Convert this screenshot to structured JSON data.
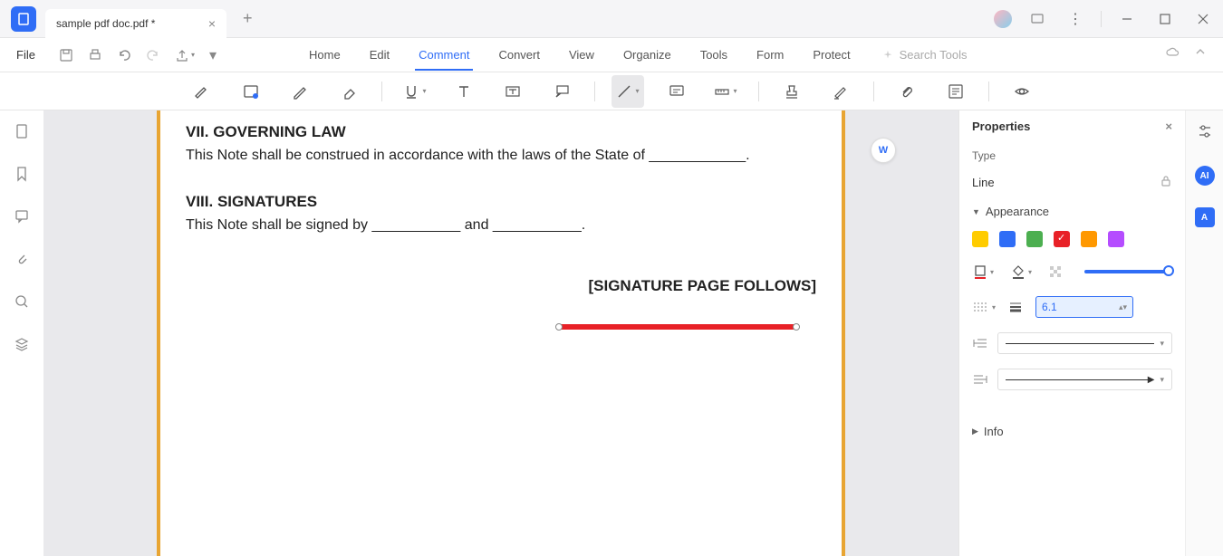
{
  "titlebar": {
    "tab_title": "sample pdf doc.pdf *"
  },
  "menubar": {
    "file": "File",
    "tabs": [
      "Home",
      "Edit",
      "Comment",
      "Convert",
      "View",
      "Organize",
      "Tools",
      "Form",
      "Protect"
    ],
    "active_index": 2,
    "search_placeholder": "Search Tools"
  },
  "document": {
    "heading1": "VII. GOVERNING LAW",
    "para1": "This Note shall be construed in accordance with the laws of the State of ____________.",
    "heading2": "VIII. SIGNATURES",
    "para2": "This Note shall be signed by ___________ and ___________.",
    "sig_follows": "[SIGNATURE PAGE FOLLOWS]"
  },
  "properties": {
    "title": "Properties",
    "type_label": "Type",
    "type_value": "Line",
    "appearance_label": "Appearance",
    "thickness_value": "6.1",
    "info_label": "Info"
  }
}
